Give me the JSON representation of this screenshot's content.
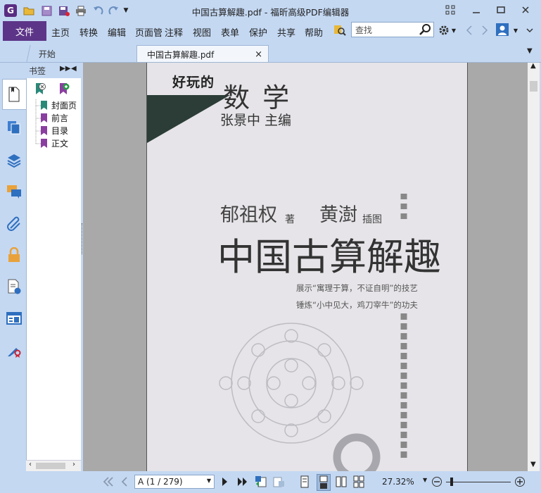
{
  "window": {
    "title": "中国古算解趣.pdf - 福昕高级PDF编辑器"
  },
  "menu": {
    "file": "文件",
    "items": [
      "主页",
      "转换",
      "编辑",
      "页面管",
      "注释",
      "视图",
      "表单",
      "保护",
      "共享",
      "帮助"
    ],
    "search_placeholder": "查找"
  },
  "tabs": [
    {
      "label": "开始",
      "active": false
    },
    {
      "label": "中国古算解趣.pdf",
      "active": true,
      "close": "×"
    }
  ],
  "bookmarks": {
    "title": "书签",
    "items": [
      {
        "label": "封面页",
        "color": "#2a8a7a"
      },
      {
        "label": "前言",
        "color": "#8a3fa0"
      },
      {
        "label": "目录",
        "color": "#8a3fa0"
      },
      {
        "label": "正文",
        "color": "#8a3fa0"
      }
    ]
  },
  "document": {
    "series_small": "好玩的",
    "series_big": "数 学",
    "editor": "张景中 主编",
    "author": "郁祖权",
    "author_role": "著",
    "illustrator": "黄澍",
    "illustrator_role": "插图",
    "title": "中国古算解趣",
    "tagline1": "展示“寓理于算，不证自明”的技艺",
    "tagline2": "锤炼“小中见大，鸡刀宰牛”的功夫"
  },
  "statusbar": {
    "page_indicator": "A (1 / 279)",
    "zoom": "27.32%"
  },
  "colors": {
    "chrome": "#c4d8f2",
    "file_tab": "#5d3588",
    "cover_bg": "#e6e4e8",
    "cover_dark": "#2b3d36"
  },
  "icons": [
    "app-logo-icon",
    "open-folder-icon",
    "save-icon",
    "save-as-icon",
    "print-icon",
    "undo-icon",
    "redo-icon",
    "search-icon",
    "settings-icon",
    "user-icon",
    "bookmark-panel-icon",
    "pages-icon",
    "layers-icon",
    "comments-icon",
    "attachment-icon",
    "security-icon",
    "document-properties-icon",
    "form-fields-icon",
    "signature-icon",
    "first-page-icon",
    "previous-page-icon",
    "next-page-icon",
    "last-page-icon",
    "zoom-out-icon",
    "zoom-in-icon"
  ]
}
